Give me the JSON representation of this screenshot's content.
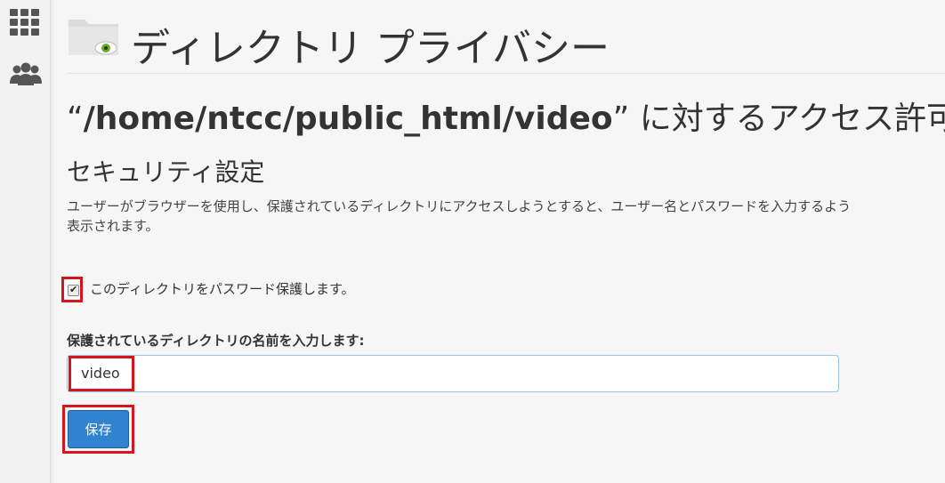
{
  "sidebar": {
    "icons": [
      {
        "name": "apps-grid-icon"
      },
      {
        "name": "users-icon"
      }
    ]
  },
  "header": {
    "title": "ディレクトリ プライバシー",
    "icon": "folder-eye-icon"
  },
  "directory": {
    "quote_open": "“",
    "path": "/home/ntcc/public_html/video",
    "quote_close": "”",
    "suffix": " に対するアクセス許可を"
  },
  "security": {
    "title": "セキュリティ設定",
    "description_line1": "ユーザーがブラウザーを使用し、保護されているディレクトリにアクセスしようとすると、ユーザー名とパスワードを入力するよう",
    "description_line2": "表示されます。"
  },
  "protect": {
    "label": "このディレクトリをパスワード保護します。",
    "checked": true
  },
  "name_field": {
    "label": "保護されているディレクトリの名前を入力します:",
    "value": "video"
  },
  "save": {
    "label": "保存"
  },
  "colors": {
    "highlight": "#d8141d",
    "button": "#2f83cf"
  }
}
